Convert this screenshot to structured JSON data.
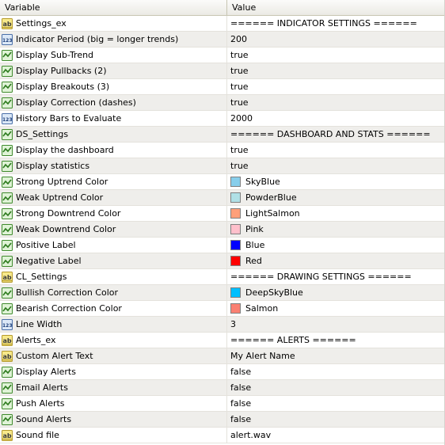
{
  "header": {
    "variable": "Variable",
    "value": "Value"
  },
  "rows": [
    {
      "type": "string",
      "label": "Settings_ex",
      "value": "====== INDICATOR SETTINGS ======"
    },
    {
      "type": "int",
      "label": "Indicator Period (big = longer trends)",
      "value": "200"
    },
    {
      "type": "bool",
      "label": "Display Sub-Trend",
      "value": "true"
    },
    {
      "type": "bool",
      "label": "Display Pullbacks (2)",
      "value": "true"
    },
    {
      "type": "bool",
      "label": "Display Breakouts (3)",
      "value": "true"
    },
    {
      "type": "bool",
      "label": "Display Correction (dashes)",
      "value": "true"
    },
    {
      "type": "int",
      "label": "History Bars to Evaluate",
      "value": "2000"
    },
    {
      "type": "bool",
      "label": "DS_Settings",
      "value": "====== DASHBOARD AND STATS ======"
    },
    {
      "type": "bool",
      "label": "Display the dashboard",
      "value": "true"
    },
    {
      "type": "bool",
      "label": "Display statistics",
      "value": "true"
    },
    {
      "type": "color",
      "label": "Strong Uptrend Color",
      "value": "SkyBlue",
      "color": "#87ceeb"
    },
    {
      "type": "color",
      "label": "Weak Uptrend Color",
      "value": "PowderBlue",
      "color": "#b0e0e6"
    },
    {
      "type": "color",
      "label": "Strong Downtrend Color",
      "value": "LightSalmon",
      "color": "#ffa07a"
    },
    {
      "type": "color",
      "label": "Weak Downtrend Color",
      "value": "Pink",
      "color": "#ffc0cb"
    },
    {
      "type": "color",
      "label": "Positive Label",
      "value": "Blue",
      "color": "#0000ff"
    },
    {
      "type": "color",
      "label": "Negative Label",
      "value": "Red",
      "color": "#ff0000"
    },
    {
      "type": "string",
      "label": "CL_Settings",
      "value": "====== DRAWING SETTINGS ======"
    },
    {
      "type": "color",
      "label": "Bullish Correction Color",
      "value": "DeepSkyBlue",
      "color": "#00bfff"
    },
    {
      "type": "color",
      "label": "Bearish Correction Color",
      "value": "Salmon",
      "color": "#fa8072"
    },
    {
      "type": "int",
      "label": "Line Width",
      "value": "3"
    },
    {
      "type": "string",
      "label": "Alerts_ex",
      "value": "====== ALERTS ======"
    },
    {
      "type": "string",
      "label": "Custom Alert Text",
      "value": "My Alert Name"
    },
    {
      "type": "bool",
      "label": "Display Alerts",
      "value": "false"
    },
    {
      "type": "bool",
      "label": "Email Alerts",
      "value": "false"
    },
    {
      "type": "bool",
      "label": "Push Alerts",
      "value": "false"
    },
    {
      "type": "bool",
      "label": "Sound Alerts",
      "value": "false"
    },
    {
      "type": "string",
      "label": "Sound file",
      "value": "alert.wav"
    }
  ]
}
